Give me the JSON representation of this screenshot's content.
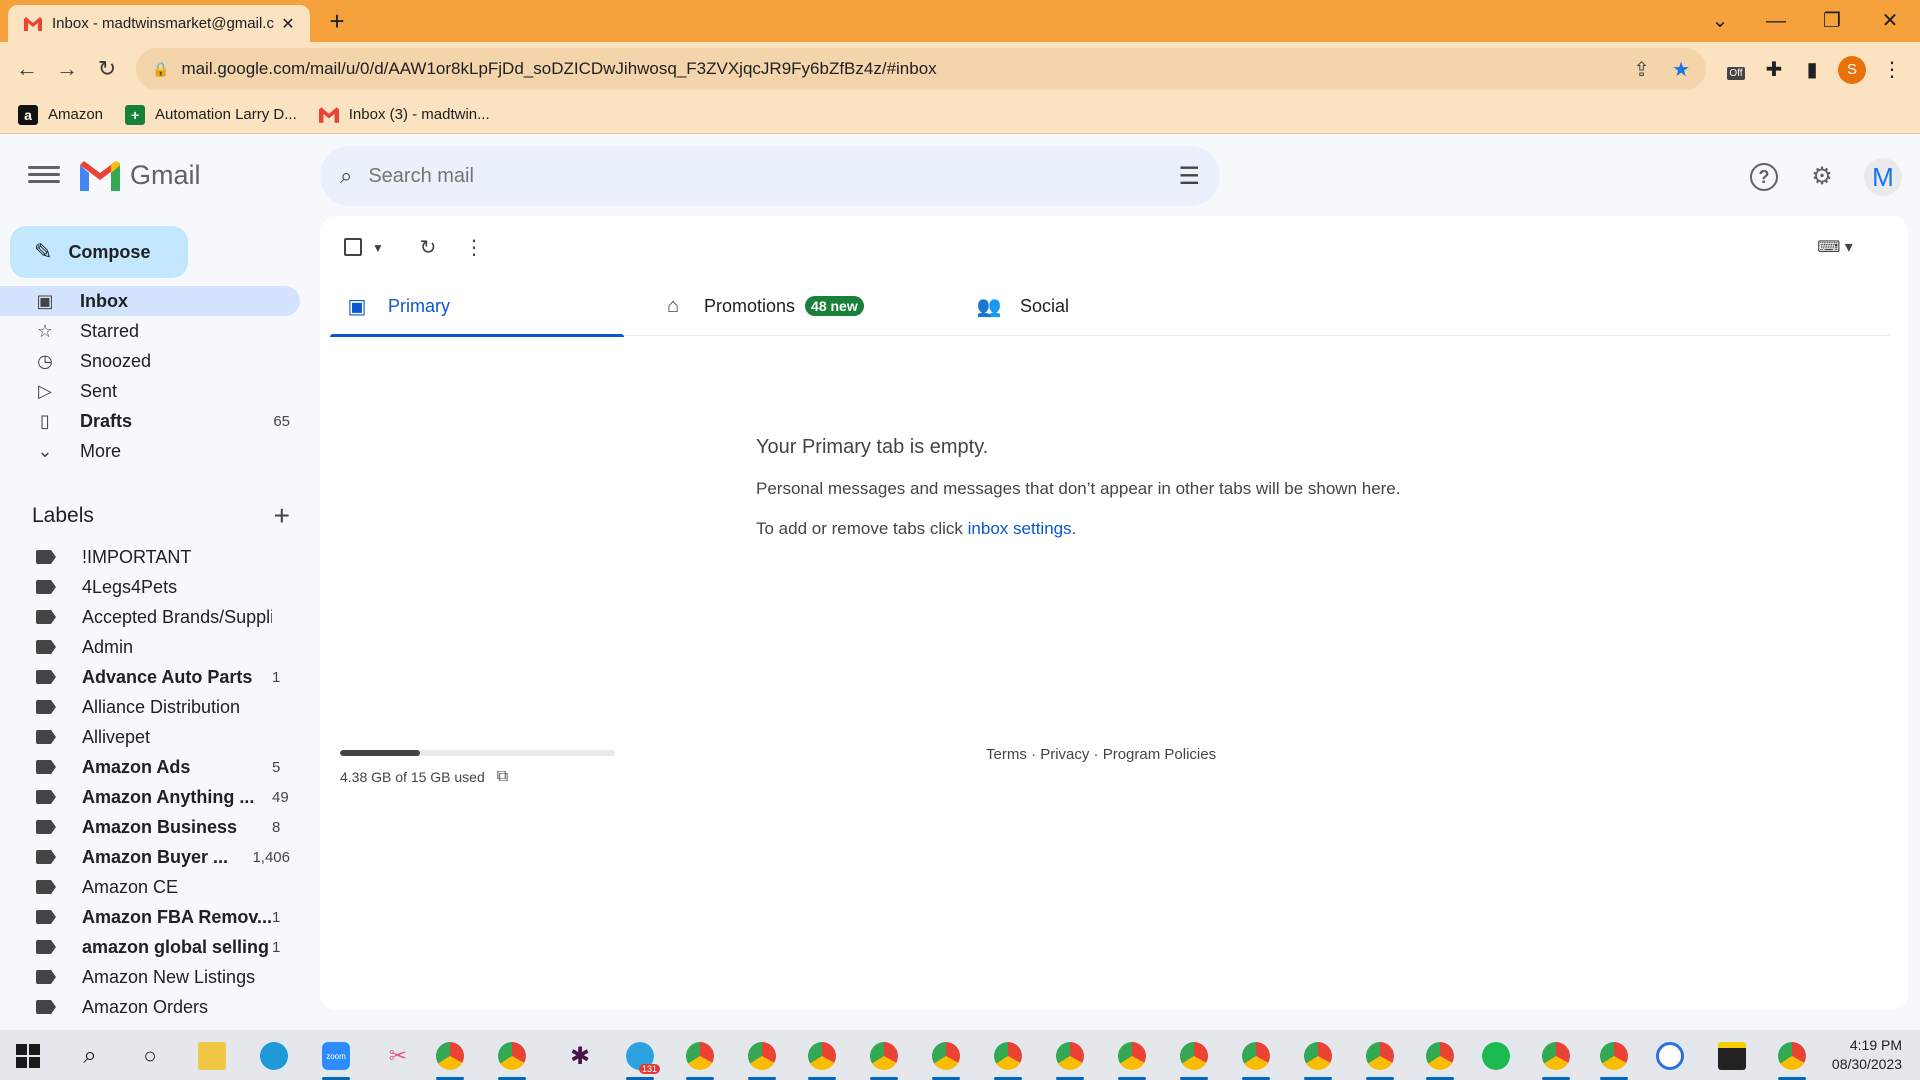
{
  "browser": {
    "tab_title": "Inbox - madtwinsmarket@gmail.c",
    "url": "mail.google.com/mail/u/0/d/AAW1or8kLpFjDd_soDZICDwJihwosq_F3ZVXjqcJR9Fy6bZfBz4z/#inbox",
    "profile_initial": "S",
    "ext_off_label": "Off",
    "bookmarks": [
      {
        "label": "Amazon",
        "icon": "amazon-icon"
      },
      {
        "label": "Automation Larry D...",
        "icon": "sheets-icon"
      },
      {
        "label": "Inbox (3) - madtwin...",
        "icon": "gmail-icon"
      }
    ]
  },
  "gmail": {
    "brand": "Gmail",
    "search_placeholder": "Search mail",
    "avatar_initial": "M",
    "compose_label": "Compose",
    "nav": [
      {
        "label": "Inbox",
        "icon": "inbox-icon",
        "count": "",
        "bold": true,
        "active": true
      },
      {
        "label": "Starred",
        "icon": "star-icon",
        "count": "",
        "bold": false,
        "active": false
      },
      {
        "label": "Snoozed",
        "icon": "clock-icon",
        "count": "",
        "bold": false,
        "active": false
      },
      {
        "label": "Sent",
        "icon": "send-icon",
        "count": "",
        "bold": false,
        "active": false
      },
      {
        "label": "Drafts",
        "icon": "draft-icon",
        "count": "65",
        "bold": true,
        "active": false
      },
      {
        "label": "More",
        "icon": "chevron-down-icon",
        "count": "",
        "bold": false,
        "active": false
      }
    ],
    "labels_title": "Labels",
    "labels": [
      {
        "name": "!IMPORTANT",
        "count": "",
        "bold": false
      },
      {
        "name": "4Legs4Pets",
        "count": "",
        "bold": false
      },
      {
        "name": "Accepted Brands/Suppli...",
        "count": "",
        "bold": false
      },
      {
        "name": "Admin",
        "count": "",
        "bold": false
      },
      {
        "name": "Advance Auto Parts",
        "count": "1",
        "bold": true
      },
      {
        "name": "Alliance Distribution",
        "count": "",
        "bold": false
      },
      {
        "name": "Allivepet",
        "count": "",
        "bold": false
      },
      {
        "name": "Amazon Ads",
        "count": "5",
        "bold": true
      },
      {
        "name": "Amazon Anything ...",
        "count": "49",
        "bold": true
      },
      {
        "name": "Amazon Business",
        "count": "8",
        "bold": true
      },
      {
        "name": "Amazon Buyer ...",
        "count": "1,406",
        "bold": true
      },
      {
        "name": "Amazon CE",
        "count": "",
        "bold": false
      },
      {
        "name": "Amazon FBA Remov...",
        "count": "1",
        "bold": true
      },
      {
        "name": "amazon global selling",
        "count": "1",
        "bold": true
      },
      {
        "name": "Amazon New Listings",
        "count": "",
        "bold": false
      },
      {
        "name": "Amazon Orders",
        "count": "",
        "bold": false
      }
    ],
    "tabs": [
      {
        "label": "Primary",
        "icon": "inbox-icon",
        "badge": "",
        "active": true
      },
      {
        "label": "Promotions",
        "icon": "tag-icon",
        "badge": "48 new",
        "active": false
      },
      {
        "label": "Social",
        "icon": "people-icon",
        "badge": "",
        "active": false
      }
    ],
    "empty": {
      "title": "Your Primary tab is empty.",
      "body": "Personal messages and messages that don’t appear in other tabs will be shown here.",
      "hint_prefix": "To add or remove tabs click ",
      "hint_link": "inbox settings",
      "hint_suffix": "."
    },
    "storage": {
      "text": "4.38 GB of 15 GB used",
      "fraction": 0.292
    },
    "footer": {
      "terms": "Terms",
      "privacy": "Privacy",
      "policies": "Program Policies",
      "sep": " · "
    }
  },
  "taskbar": {
    "time": "4:19 PM",
    "date": "08/30/2023",
    "telegram_badge": "131",
    "zoom_label": "zoom"
  },
  "colors": {
    "accent": "#0b57d0",
    "compose_bg": "#c2e7ff",
    "badge_green": "#188038",
    "chrome_orange": "#f6a23c"
  }
}
